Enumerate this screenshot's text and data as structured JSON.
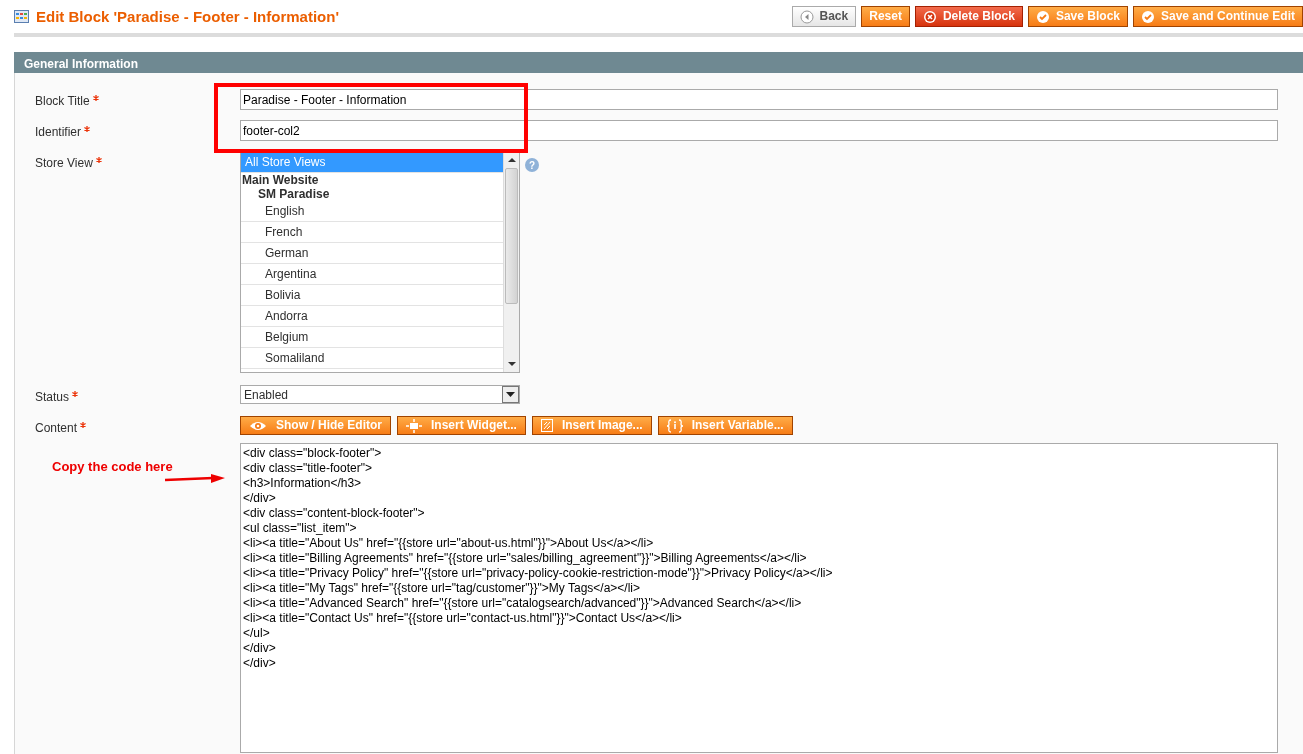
{
  "page_title": "Edit Block 'Paradise - Footer - Information'",
  "buttons": [
    {
      "label": "Back",
      "kind": "back"
    },
    {
      "label": "Reset",
      "kind": "reset"
    },
    {
      "label": "Delete Block",
      "kind": "delete"
    },
    {
      "label": "Save Block",
      "kind": "save"
    },
    {
      "label": "Save and Continue Edit",
      "kind": "save"
    }
  ],
  "section_title": "General Information",
  "fields": [
    {
      "label": "Block Title",
      "required": true,
      "kind": "text",
      "value": "Paradise - Footer - Information"
    },
    {
      "label": "Identifier",
      "required": true,
      "kind": "text",
      "value": "footer-col2"
    },
    {
      "label": "Store View",
      "required": true,
      "kind": "multiselect",
      "help": "?",
      "options": [
        {
          "label": "All Store Views",
          "selected": true
        },
        {
          "label": "Main Website",
          "kind": "group",
          "children": [
            {
              "label": "SM Paradise",
              "kind": "group",
              "children": [
                {
                  "label": "English",
                  "selected": false
                },
                {
                  "label": "French",
                  "selected": false
                },
                {
                  "label": "German",
                  "selected": false
                },
                {
                  "label": "Argentina",
                  "selected": false
                },
                {
                  "label": "Bolivia",
                  "selected": false
                },
                {
                  "label": "Andorra",
                  "selected": false
                },
                {
                  "label": "Belgium",
                  "selected": false
                },
                {
                  "label": "Somaliland",
                  "selected": false
                }
              ]
            }
          ]
        }
      ]
    },
    {
      "label": "Status",
      "required": true,
      "kind": "select",
      "value": "Enabled"
    },
    {
      "label": "Content",
      "required": true,
      "kind": "editor",
      "editor_buttons": [
        {
          "label": "Show / Hide Editor",
          "kind": "eye"
        },
        {
          "label": "Insert Widget...",
          "kind": "widget"
        },
        {
          "label": "Insert Image...",
          "kind": "image"
        },
        {
          "label": "Insert Variable...",
          "kind": "variable"
        }
      ],
      "lines": [
        "<div class=\"block-footer\">",
        "<div class=\"title-footer\">",
        "<h3>Information</h3>",
        "</div>",
        "<div class=\"content-block-footer\">",
        "<ul class=\"list_item\">",
        "<li><a title=\"About Us\" href=\"{{store url=\"about-us.html\"}}\">About Us</a></li>",
        "<li><a title=\"Billing Agreements\" href=\"{{store url=\"sales/billing_agreement\"}}\">Billing Agreements</a></li>",
        "<li><a title=\"Privacy Policy\" href=\"{{store url=\"privacy-policy-cookie-restriction-mode\"}}\">Privacy Policy</a></li>",
        "<li><a title=\"My Tags\" href=\"{{store url=\"tag/customer\"}}\">My Tags</a></li>",
        "<li><a title=\"Advanced Search\" href=\"{{store url=\"catalogsearch/advanced\"}}\">Advanced Search</a></li>",
        "<li><a title=\"Contact Us\" href=\"{{store url=\"contact-us.html\"}}\">Contact Us</a></li>",
        "</ul>",
        "</div>",
        "</div>"
      ]
    }
  ],
  "annotation": {
    "text": "Copy the code here"
  }
}
